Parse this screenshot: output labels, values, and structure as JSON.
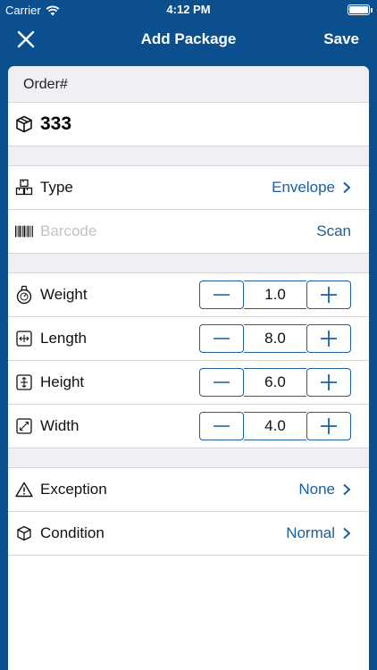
{
  "status_bar": {
    "carrier": "Carrier",
    "time": "4:12 PM"
  },
  "navbar": {
    "title": "Add Package",
    "save_label": "Save"
  },
  "order": {
    "header": "Order#",
    "value": "333"
  },
  "package": {
    "type_label": "Type",
    "type_value": "Envelope",
    "barcode_placeholder": "Barcode",
    "scan_label": "Scan"
  },
  "dimensions": [
    {
      "label": "Weight",
      "value": "1.0",
      "icon": "scale-icon"
    },
    {
      "label": "Length",
      "value": "8.0",
      "icon": "length-icon"
    },
    {
      "label": "Height",
      "value": "6.0",
      "icon": "height-icon"
    },
    {
      "label": "Width",
      "value": "4.0",
      "icon": "width-icon"
    }
  ],
  "status": {
    "exception_label": "Exception",
    "exception_value": "None",
    "condition_label": "Condition",
    "condition_value": "Normal"
  },
  "colors": {
    "brand": "#0b4f8e",
    "accent": "#1a5fa0",
    "section_bg": "#efeff4"
  }
}
